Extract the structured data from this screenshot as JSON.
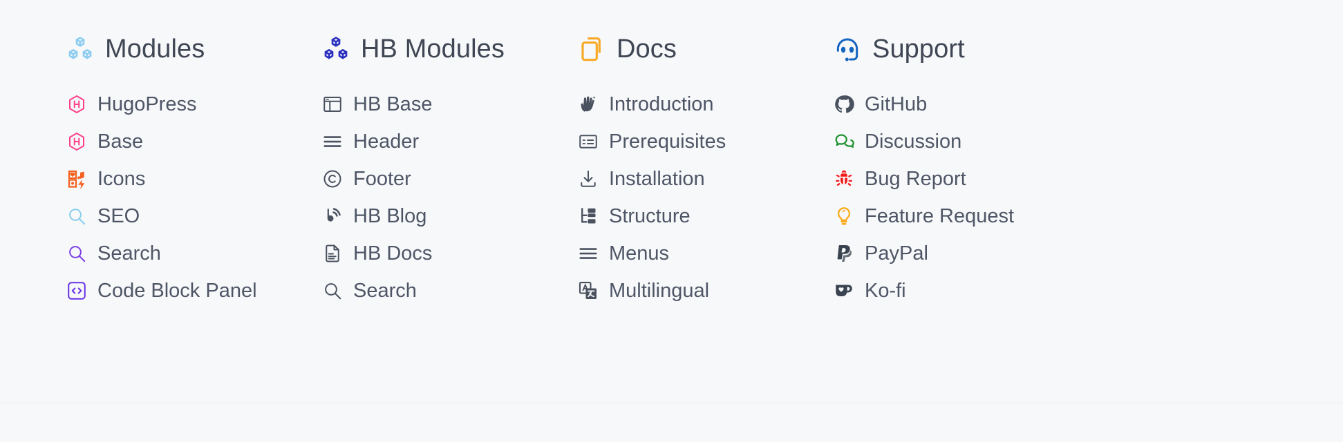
{
  "theme": {
    "background": "#f7f8fa",
    "heading_color": "#3f4654",
    "link_color": "#4e5666"
  },
  "columns": [
    {
      "title": "Modules",
      "icon": "cubes-icon",
      "icon_color": "#8ecdf0",
      "items": [
        {
          "label": "HugoPress",
          "icon": "hugo-hexagon-icon",
          "icon_color": "#ff4088"
        },
        {
          "label": "Base",
          "icon": "hugo-hexagon-icon",
          "icon_color": "#ff4088"
        },
        {
          "label": "Icons",
          "icon": "icon-grid-icon",
          "icon_color": "#f4601f"
        },
        {
          "label": "SEO",
          "icon": "magnifier-icon",
          "icon_color": "#87cdeb"
        },
        {
          "label": "Search",
          "icon": "magnifier-icon",
          "icon_color": "#7b3fe4"
        },
        {
          "label": "Code Block Panel",
          "icon": "code-brackets-icon",
          "icon_color": "#6730e3"
        }
      ]
    },
    {
      "title": "HB Modules",
      "icon": "cubes-icon",
      "icon_color": "#2a2fbf",
      "items": [
        {
          "label": "HB Base",
          "icon": "layout-window-icon",
          "icon_color": "#4a5260"
        },
        {
          "label": "Header",
          "icon": "hamburger-icon",
          "icon_color": "#4a5260"
        },
        {
          "label": "Footer",
          "icon": "copyright-icon",
          "icon_color": "#4a5260"
        },
        {
          "label": "HB Blog",
          "icon": "blog-signal-icon",
          "icon_color": "#4a5260"
        },
        {
          "label": "HB Docs",
          "icon": "document-text-icon",
          "icon_color": "#4a5260"
        },
        {
          "label": "Search",
          "icon": "magnifier-icon",
          "icon_color": "#4a5260"
        }
      ]
    },
    {
      "title": "Docs",
      "icon": "copy-pages-icon",
      "icon_color": "#f9a825",
      "items": [
        {
          "label": "Introduction",
          "icon": "waving-hand-icon",
          "icon_color": "#4a5260"
        },
        {
          "label": "Prerequisites",
          "icon": "checklist-icon",
          "icon_color": "#4a5260"
        },
        {
          "label": "Installation",
          "icon": "download-icon",
          "icon_color": "#4a5260"
        },
        {
          "label": "Structure",
          "icon": "tree-nodes-icon",
          "icon_color": "#4a5260"
        },
        {
          "label": "Menus",
          "icon": "hamburger-icon",
          "icon_color": "#4a5260"
        },
        {
          "label": "Multilingual",
          "icon": "translate-icon",
          "icon_color": "#4a5260"
        }
      ]
    },
    {
      "title": "Support",
      "icon": "headset-icon",
      "icon_color": "#1565c0",
      "items": [
        {
          "label": "GitHub",
          "icon": "github-icon",
          "icon_color": "#4a5260"
        },
        {
          "label": "Discussion",
          "icon": "chat-bubbles-icon",
          "icon_color": "#1f9130"
        },
        {
          "label": "Bug Report",
          "icon": "bug-icon",
          "icon_color": "#f51a1a"
        },
        {
          "label": "Feature Request",
          "icon": "lightbulb-icon",
          "icon_color": "#fbaa19"
        },
        {
          "label": "PayPal",
          "icon": "paypal-icon",
          "icon_color": "#3a4350"
        },
        {
          "label": "Ko-fi",
          "icon": "kofi-icon",
          "icon_color": "#3a4350"
        }
      ]
    }
  ]
}
